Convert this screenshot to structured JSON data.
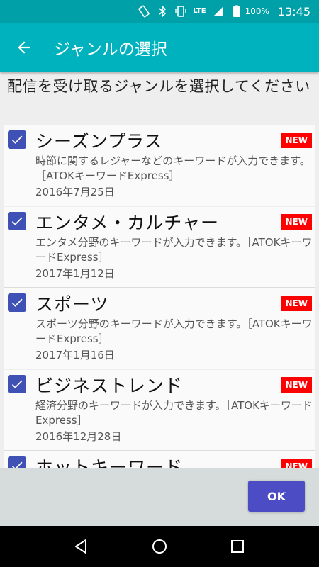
{
  "status_bar": {
    "lte": "LTE",
    "battery": "100%",
    "time": "13:45"
  },
  "app_bar": {
    "title": "ジャンルの選択"
  },
  "instruction": "配信を受け取るジャンルを選択してください",
  "genres": [
    {
      "title": "シーズンプラス",
      "badge": "NEW",
      "description": "時節に関するレジャーなどのキーワードが入力できます。［ATOKキーワードExpress］",
      "date": "2016年7月25日",
      "checked": true
    },
    {
      "title": "エンタメ・カルチャー",
      "badge": "NEW",
      "description": "エンタメ分野のキーワードが入力できます。［ATOKキーワードExpress］",
      "date": "2017年1月12日",
      "checked": true
    },
    {
      "title": "スポーツ",
      "badge": "NEW",
      "description": "スポーツ分野のキーワードが入力できます。［ATOKキーワードExpress］",
      "date": "2017年1月16日",
      "checked": true
    },
    {
      "title": "ビジネストレンド",
      "badge": "NEW",
      "description": "経済分野のキーワードが入力できます。［ATOKキーワードExpress］",
      "date": "2016年12月28日",
      "checked": true
    },
    {
      "title": "ホットキーワード",
      "badge": "NEW",
      "description": "",
      "date": "",
      "checked": true
    }
  ],
  "actions": {
    "ok_label": "OK"
  },
  "colors": {
    "status_bar": "#00a0a8",
    "app_bar": "#00b2bd",
    "checkbox": "#3f51b5",
    "badge": "#ff0000",
    "ok_button": "#4c4dc4"
  }
}
